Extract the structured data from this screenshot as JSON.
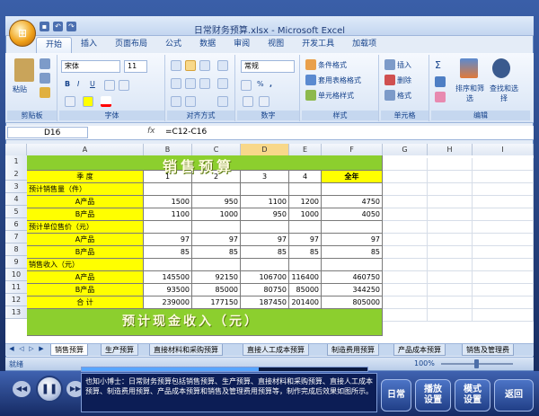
{
  "window": {
    "title": "日常财务预算.xlsx - Microsoft Excel"
  },
  "ribbon_tabs": [
    "开始",
    "插入",
    "页面布局",
    "公式",
    "数据",
    "审阅",
    "视图",
    "开发工具",
    "加载项"
  ],
  "ribbon": {
    "clipboard": {
      "label": "剪贴板",
      "paste": "粘贴"
    },
    "font": {
      "label": "字体",
      "name": "宋体",
      "size": "11",
      "bold": "B",
      "italic": "I",
      "underline": "U"
    },
    "alignment": {
      "label": "对齐方式"
    },
    "number": {
      "label": "数字",
      "format": "常规",
      "percent": "%",
      "comma": ","
    },
    "styles": {
      "label": "样式",
      "conditional": "条件格式",
      "table": "套用表格格式",
      "cell": "单元格样式"
    },
    "cells": {
      "label": "单元格",
      "insert": "插入",
      "delete": "删除",
      "format": "格式"
    },
    "editing": {
      "label": "编辑",
      "sort": "排序和筛选",
      "find": "查找和选择",
      "sigma": "Σ"
    }
  },
  "formula_bar": {
    "name_box": "D16",
    "fx": "fx",
    "formula": "=C12-C16"
  },
  "columns": [
    "A",
    "B",
    "C",
    "D",
    "E",
    "F",
    "G",
    "H",
    "I"
  ],
  "rows": [
    "1",
    "2",
    "3",
    "4",
    "5",
    "6",
    "7",
    "8",
    "9",
    "10",
    "11",
    "12",
    "13"
  ],
  "sheet": {
    "banner1": "销售预算",
    "banner2": "预计现金收入（元）",
    "header": {
      "label": "季  度",
      "q1": "1",
      "q2": "2",
      "q3": "3",
      "q4": "4",
      "total": "全年"
    },
    "r3": "预计销售量（件）",
    "r4": {
      "label": "A产品",
      "v": [
        "1500",
        "950",
        "1100",
        "1200",
        "4750"
      ]
    },
    "r5": {
      "label": "B产品",
      "v": [
        "1100",
        "1000",
        "950",
        "1000",
        "4050"
      ]
    },
    "r6": "预计单位售价（元）",
    "r7": {
      "label": "A产品",
      "v": [
        "97",
        "97",
        "97",
        "97",
        "97"
      ]
    },
    "r8": {
      "label": "B产品",
      "v": [
        "85",
        "85",
        "85",
        "85",
        "85"
      ]
    },
    "r9": "销售收入（元）",
    "r10": {
      "label": "A产品",
      "v": [
        "145500",
        "92150",
        "106700",
        "116400",
        "460750"
      ]
    },
    "r11": {
      "label": "B产品",
      "v": [
        "93500",
        "85000",
        "80750",
        "85000",
        "344250"
      ]
    },
    "r12": {
      "label": "合  计",
      "v": [
        "239000",
        "177150",
        "187450",
        "201400",
        "805000"
      ]
    }
  },
  "sheet_tabs": [
    "销售预算",
    "生产预算",
    "直接材料和采购预算",
    "直接人工成本预算",
    "制造费用预算",
    "产品成本预算",
    "销售及管理费"
  ],
  "status": {
    "ready": "就绪",
    "zoom": "100%"
  },
  "player": {
    "progress": 0.62,
    "tip": "也知小博士：日常财务预算包括销售预算、生产预算、直接材料和采购预算、直接人工成本预算、制造费用预算、产品成本预算和销售及管理费用预算等，制作完成后效果如图所示。",
    "btn_daily": "日常",
    "btn_play": "播放\n设置",
    "btn_mode": "模式\n设置",
    "btn_back": "返回"
  }
}
